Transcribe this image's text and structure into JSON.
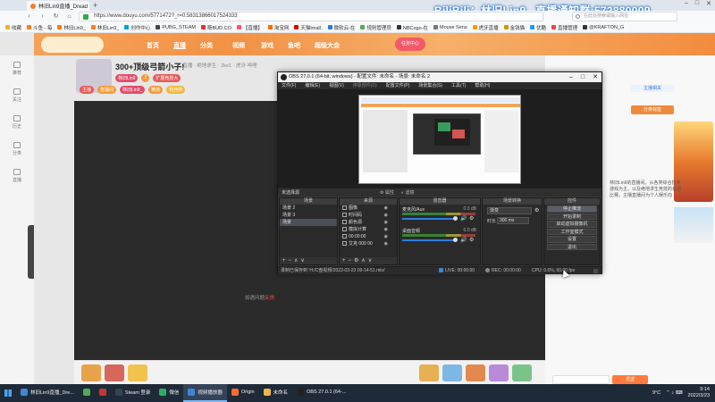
{
  "browser": {
    "tab_title": "林旧Lin9直播_Dread H",
    "new_tab": "+",
    "url": "https://www.douyu.com/5771472?_r=0.58313866017524333",
    "search_placeholder": "在此处搜索或输入网址",
    "bookmarks": [
      {
        "label": "收藏",
        "color": "#f0b429"
      },
      {
        "label": "斗鱼 - 每",
        "color": "#ff7a1a"
      },
      {
        "label": "林旧Lin9_",
        "color": "#ff7a1a"
      },
      {
        "label": "林旧Lin9_",
        "color": "#ff7a1a"
      },
      {
        "label": "创作中心",
        "color": "#00a1d6"
      },
      {
        "label": "PUBG_STEAM",
        "color": "#444444"
      },
      {
        "label": "斯BUD.CO",
        "color": "#d33"
      },
      {
        "label": "【直播】",
        "color": "#f56"
      },
      {
        "label": "淘宝网",
        "color": "#f60"
      },
      {
        "label": "天猫tmall.",
        "color": "#d00"
      },
      {
        "label": "微软云-在",
        "color": "#2a7ae2"
      },
      {
        "label": "规则管理员",
        "color": "#5a5"
      },
      {
        "label": "NBCogo-在",
        "color": "#333"
      },
      {
        "label": "Mouse Sens",
        "color": "#777"
      },
      {
        "label": "虎牙直播",
        "color": "#f90"
      },
      {
        "label": "金钱猫",
        "color": "#c90"
      },
      {
        "label": "优酷",
        "color": "#29f"
      },
      {
        "label": "直播管理",
        "color": "#e44"
      },
      {
        "label": "@KRAFTON_G",
        "color": "#333"
      }
    ]
  },
  "stream_banner": "BiliBili：林旧Lin9_  直播通知群:572880009",
  "douyu": {
    "nav": [
      "首页",
      "直播",
      "分类",
      "视频",
      "游戏",
      "鱼吧",
      "超级大会"
    ],
    "nav_pill": "任务中心",
    "room_title": "300+顶级弓箭小子!",
    "room_sub": "· 直播 · 绝地求生 · 2ke1 · 虎牙·哔哩",
    "tags": [
      {
        "label": "林旧Lin9",
        "color": "#e44d6b"
      },
      {
        "label": "7",
        "color": "#f39c3d"
      },
      {
        "label": "扩展竞技大",
        "color": "#e85a5a"
      }
    ],
    "tags2": [
      {
        "label": "主播",
        "color": "#e85a5a"
      },
      {
        "label": "直播间",
        "color": "#f39c3d"
      },
      {
        "label": "林旧Lin9_",
        "color": "#e44d6b"
      },
      {
        "label": "精英",
        "color": "#f39c3d"
      },
      {
        "label": "粉丝牌",
        "color": "#f2b93d"
      }
    ],
    "sidebar": [
      "推荐",
      "关注",
      "历史",
      "分类",
      "直播"
    ],
    "player_notice_prefix": "如遇问题",
    "player_notice_link": "反馈",
    "chat": {
      "tag_top": "主播相关",
      "tag": "分类标签",
      "text": "林旧Lin9的直播间。从各类综合技术游戏为主。以及绝地求生竞技的各项比赛。主播直播间为个人娱乐向",
      "send": "发送"
    }
  },
  "obs": {
    "title": "OBS 27.0.1 (64-bit, windows) - 配置文件: 未命名 - 场景: 未命名 2",
    "menu": [
      "文件(F)",
      "编辑(E)",
      "视图(V)",
      "停靠部件(D)",
      "配置文件(P)",
      "场景集合(S)",
      "工具(T)",
      "帮助(H)"
    ],
    "scenebar_label": "未选择源",
    "props_label": "属性",
    "filters_label": "滤镜",
    "docks": {
      "scenes": {
        "header": "场景",
        "items": [
          "场景 2",
          "场景 3",
          "场景"
        ],
        "selected": 2
      },
      "sources": {
        "header": "来源",
        "items": [
          "图像",
          "时间码",
          "颜色源",
          "模拟计算",
          "00:00:00",
          "艾克 000 00"
        ]
      },
      "mixer": {
        "header": "混音器",
        "channels": [
          {
            "name": "麦克风/Aux",
            "db": "0.0 dB"
          },
          {
            "name": "桌面音频",
            "db": "0.0 dB"
          }
        ]
      },
      "transitions": {
        "header": "场景转换",
        "selected": "渐变",
        "duration_label": "时长",
        "duration": "300 ms"
      },
      "controls": {
        "header": "控件",
        "buttons": [
          "停止推流",
          "开始录制",
          "启动虚拟摄像机",
          "工作室模式",
          "设置",
          "退出"
        ],
        "active": 0
      }
    },
    "status": {
      "recording_msg": "录制已保存到 'H:/C盘视频/2022-03-23 09-14-51.mkv'",
      "live_label": "LIVE:",
      "live_time": "00:00:00",
      "rec_label": "REC:",
      "rec_time": "00:00:00",
      "cpu": "CPU: 0.6%, 60.00 fps"
    }
  },
  "taskbar": {
    "items": [
      {
        "label": "林旧Lin9直播_Dre...",
        "color": "#3d86d8",
        "active": false
      },
      {
        "label": "",
        "color": "#5a5",
        "active": false
      },
      {
        "label": "",
        "color": "#c33",
        "active": false
      },
      {
        "label": "Steam 登录",
        "color": "#345",
        "active": false
      },
      {
        "label": "微信",
        "color": "#2aae67",
        "active": false
      },
      {
        "label": "视频播放器",
        "color": "#3d86d8",
        "active": true
      },
      {
        "label": "Origin",
        "color": "#f56c2d",
        "active": false
      },
      {
        "label": "未命名",
        "color": "#e8b84a",
        "active": false
      },
      {
        "label": "OBS 27.0.1 (64-...",
        "color": "#222",
        "active": false
      }
    ],
    "weather": "9°C",
    "time": "9:14",
    "date": "2022/3/23"
  }
}
